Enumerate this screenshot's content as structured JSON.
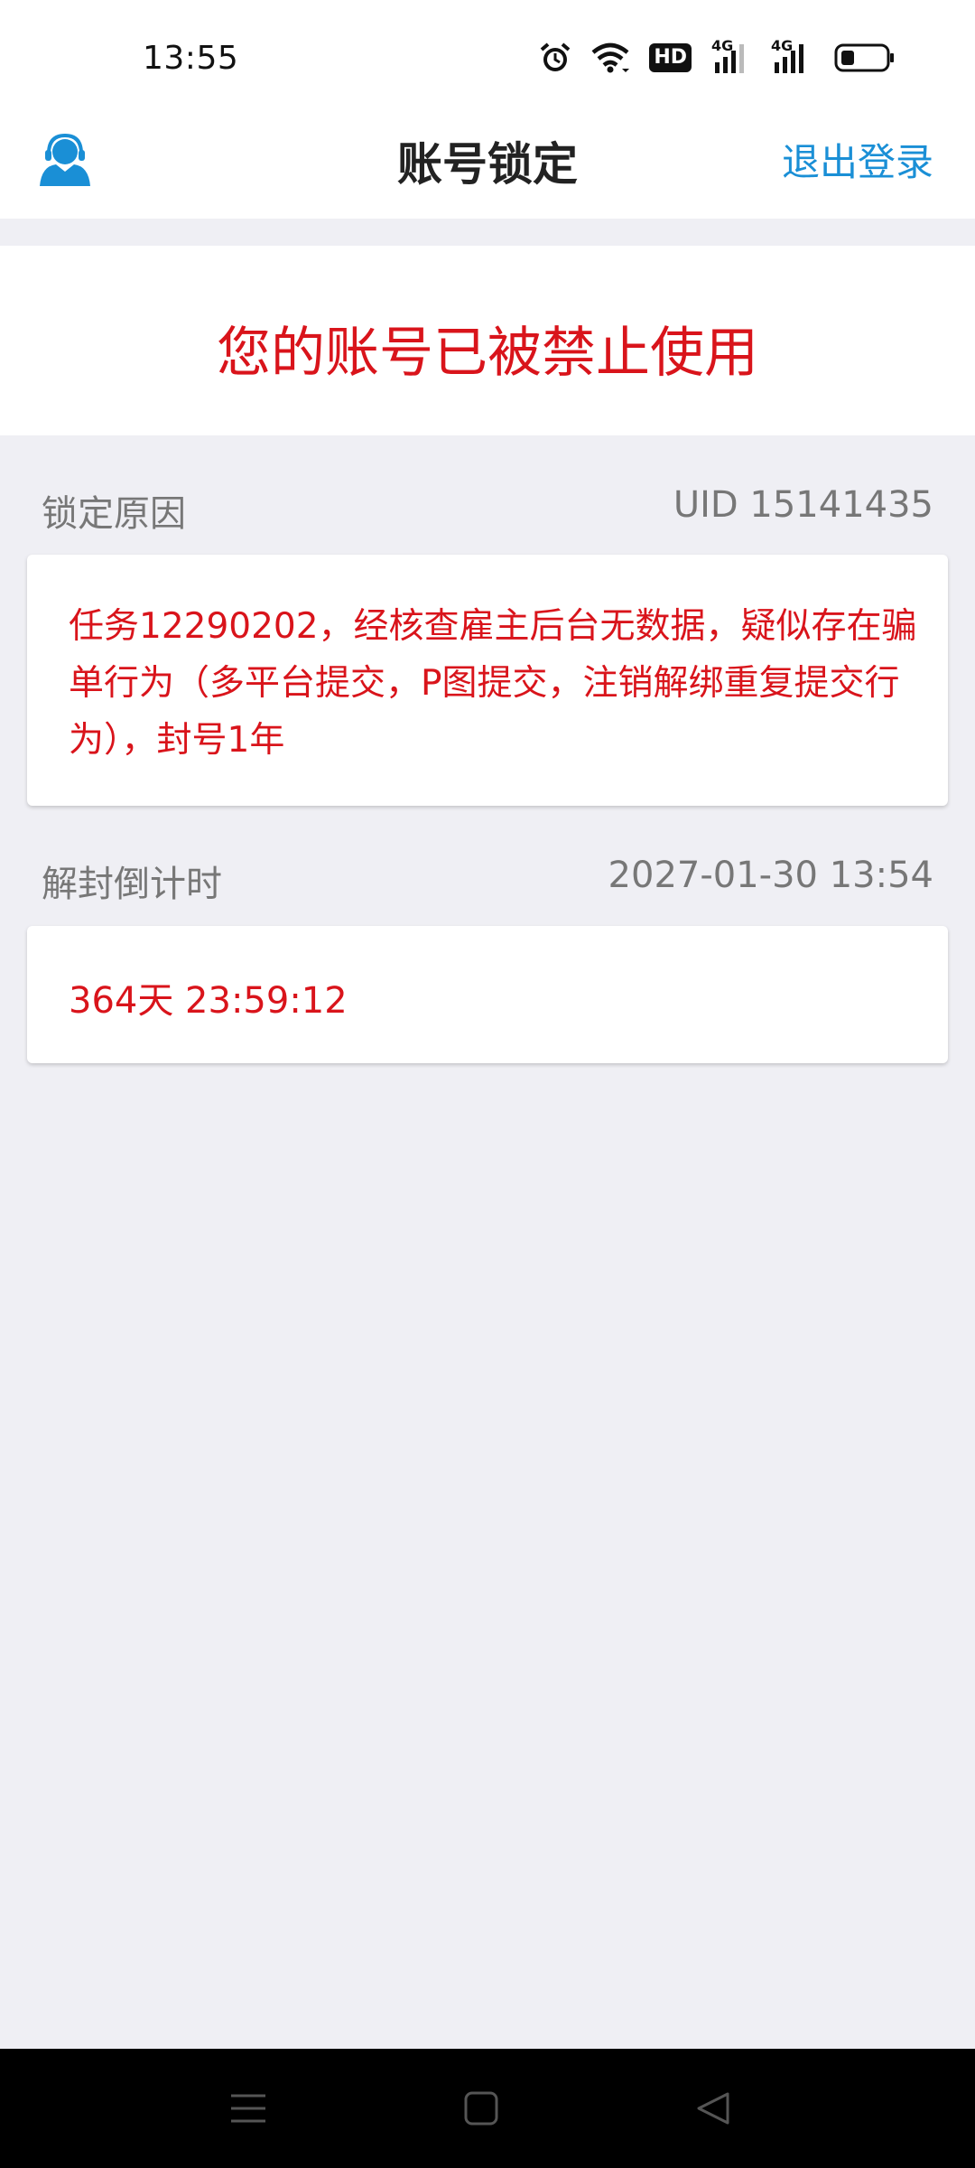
{
  "status_bar": {
    "time": "13:55",
    "icons": [
      "alarm-icon",
      "wifi-icon",
      "hd-icon",
      "signal-4g-icon",
      "signal-4g-icon",
      "battery-icon"
    ],
    "hd_label": "HD",
    "network_label": "4G"
  },
  "header": {
    "title": "账号锁定",
    "logout_label": "退出登录",
    "avatar_icon": "customer-service-icon",
    "accent_color": "#1a8fd6"
  },
  "banner": {
    "message": "您的账号已被禁止使用",
    "color": "#d9141b"
  },
  "lock_reason": {
    "label": "锁定原因",
    "uid": "UID 15141435",
    "text": "任务12290202，经核查雇主后台无数据，疑似存在骗单行为（多平台提交，P图提交，注销解绑重复提交行为），封号1年"
  },
  "unlock_countdown": {
    "label": "解封倒计时",
    "unlock_time": "2027-01-30 13:54",
    "remaining": "364天 23:59:12"
  },
  "nav_bar": {
    "buttons": [
      "menu-icon",
      "home-icon",
      "back-icon"
    ]
  }
}
